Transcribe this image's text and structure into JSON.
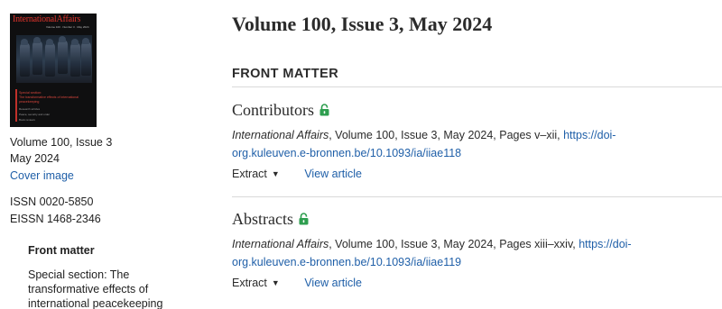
{
  "cover": {
    "masthead": "InternationalAffairs",
    "issue_line": "Volume 100 · Number 3 · May 2024",
    "special_section_heading": "Special section:",
    "special_section_title": "The transformative effects of international peacekeeping",
    "extra_lines": [
      "Research articles",
      "Peace, security and order",
      "Book reviews"
    ]
  },
  "sidebar": {
    "volume_issue": "Volume 100, Issue 3",
    "date": "May 2024",
    "cover_image_link": "Cover image",
    "issn": "ISSN 0020-5850",
    "eissn": "EISSN 1468-2346",
    "toc_heading": "Front matter",
    "toc_section": "Special section: The transformative effects of international peacekeeping"
  },
  "main": {
    "issue_title": "Volume 100, Issue 3, May 2024",
    "section_label": "FRONT MATTER",
    "articles": [
      {
        "title": "Contributors",
        "journal": "International Affairs",
        "citation": ", Volume 100, Issue 3, May 2024, Pages v–xii, ",
        "doi": "https://doi-org.kuleuven.e-bronnen.be/10.1093/ia/iiae118",
        "extract_label": "Extract",
        "view_label": "View article"
      },
      {
        "title": "Abstracts",
        "journal": "International Affairs",
        "citation": ", Volume 100, Issue 3, May 2024, Pages xiii–xxiv, ",
        "doi": "https://doi-org.kuleuven.e-bronnen.be/10.1093/ia/iiae119",
        "extract_label": "Extract",
        "view_label": "View article"
      }
    ]
  },
  "colors": {
    "link": "#1f5fa8",
    "lock": "#2e9e4f",
    "cover_red": "#e0342c"
  },
  "icons": {
    "lock": "open-lock-icon",
    "caret": "caret-down-icon"
  }
}
